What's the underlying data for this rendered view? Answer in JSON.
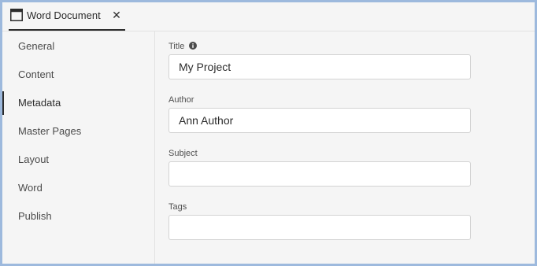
{
  "tab": {
    "icon": "window-icon",
    "title": "Word Document",
    "close_glyph": "✕"
  },
  "sidebar": {
    "selected_index": 2,
    "items": [
      {
        "label": "General"
      },
      {
        "label": "Content"
      },
      {
        "label": "Metadata"
      },
      {
        "label": "Master Pages"
      },
      {
        "label": "Layout"
      },
      {
        "label": "Word"
      },
      {
        "label": "Publish"
      }
    ]
  },
  "form": {
    "title": {
      "label": "Title",
      "value": "My Project",
      "info_icon": "info-icon"
    },
    "author": {
      "label": "Author",
      "value": "Ann Author"
    },
    "subject": {
      "label": "Subject",
      "value": ""
    },
    "tags": {
      "label": "Tags",
      "value": ""
    }
  }
}
